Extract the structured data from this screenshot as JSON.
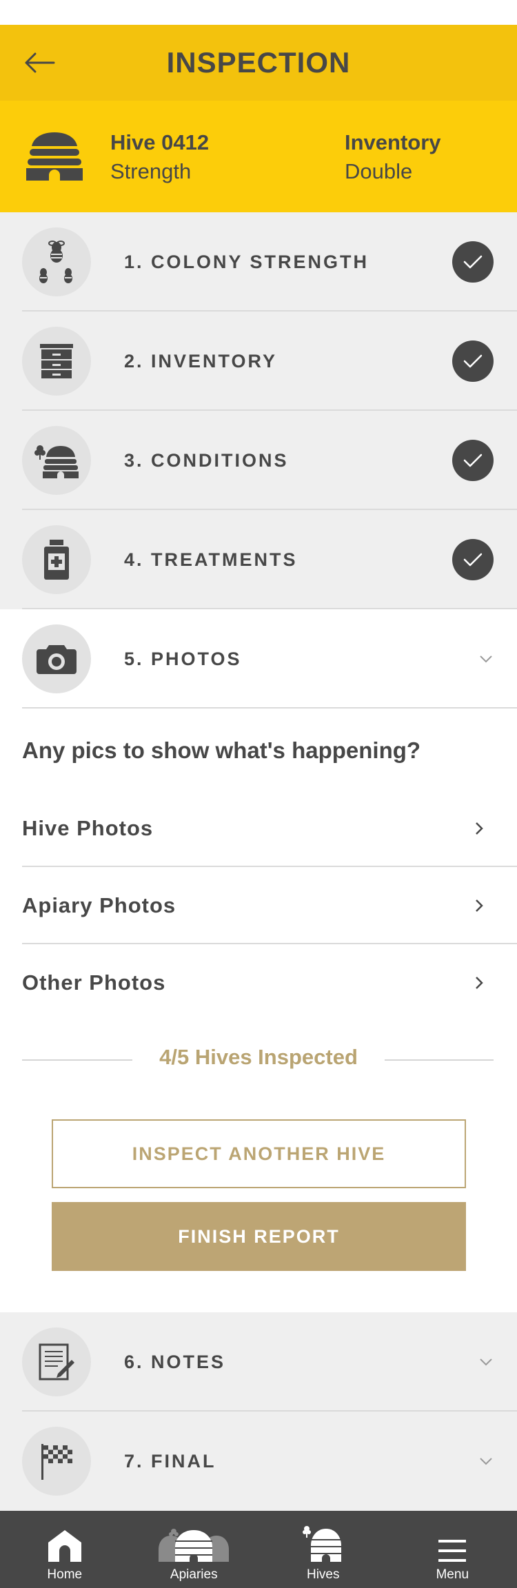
{
  "header": {
    "title": "INSPECTION",
    "back_icon": "arrow-left-icon"
  },
  "hive": {
    "icon": "beehive-icon",
    "name": "Hive 0412",
    "name_sub": "Strength",
    "type_label": "Inventory",
    "type_value": "Double"
  },
  "sections": [
    {
      "title": "1. COLONY STRENGTH",
      "icon": "bees-icon",
      "status": "complete"
    },
    {
      "title": "2. INVENTORY",
      "icon": "hive-boxes-icon",
      "status": "complete"
    },
    {
      "title": "3. CONDITIONS",
      "icon": "hive-with-tree-icon",
      "status": "complete"
    },
    {
      "title": "4. TREATMENTS",
      "icon": "medicine-bottle-icon",
      "status": "complete"
    },
    {
      "title": "5. PHOTOS",
      "icon": "camera-icon",
      "status": "expanded"
    },
    {
      "title": "6. NOTES",
      "icon": "notepad-icon",
      "status": "collapsed"
    },
    {
      "title": "7. FINAL",
      "icon": "checkered-flag-icon",
      "status": "collapsed"
    }
  ],
  "photos": {
    "prompt": "Any pics to show what's happening?",
    "rows": [
      {
        "label": "Hive Photos"
      },
      {
        "label": "Apiary Photos"
      },
      {
        "label": "Other Photos"
      }
    ]
  },
  "progress": {
    "text": "4/5 Hives Inspected"
  },
  "actions": {
    "inspect_another": "INSPECT ANOTHER HIVE",
    "finish_report": "FINISH REPORT"
  },
  "tabbar": {
    "items": [
      {
        "label": "Home",
        "icon": "home-icon"
      },
      {
        "label": "Apiaries",
        "icon": "apiaries-icon"
      },
      {
        "label": "Hives",
        "icon": "hive-icon"
      },
      {
        "label": "Menu",
        "icon": "hamburger-menu-icon"
      }
    ]
  },
  "colors": {
    "header_bg": "#f3c20d",
    "hive_info_bg": "#fccd0a",
    "accent_gold": "#bda574",
    "dark": "#474747",
    "section_bg": "#efefef"
  }
}
